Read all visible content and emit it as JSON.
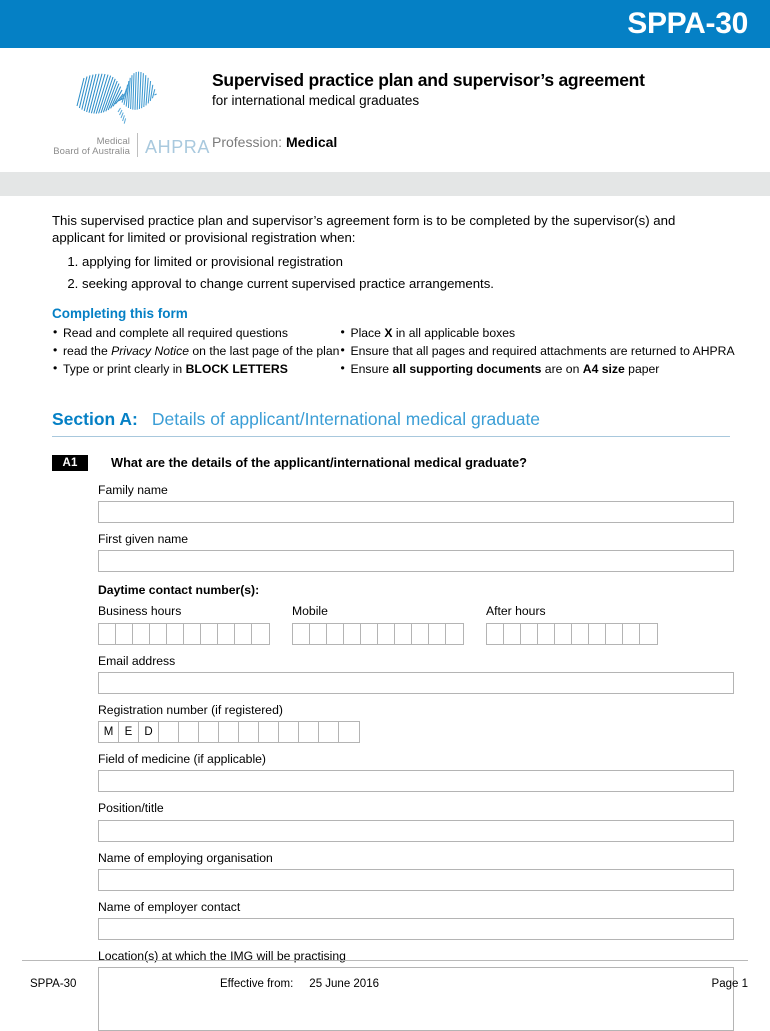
{
  "header": {
    "form_code": "SPPA-30"
  },
  "masthead": {
    "logo": {
      "board_line1": "Medical",
      "board_line2": "Board of Australia",
      "agency": "AHPRA",
      "mark_name": "australia-map-logo"
    },
    "title": "Supervised practice plan and supervisor’s agreement",
    "subtitle": "for international medical graduates",
    "profession_label": "Profession:",
    "profession_value": "Medical"
  },
  "intro": {
    "paragraph": "This supervised practice plan and supervisor’s agreement form is to be completed by the supervisor(s) and applicant for limited or provisional registration when:",
    "items": [
      "applying for limited or provisional registration",
      "seeking approval to change current supervised practice arrangements."
    ]
  },
  "completing": {
    "heading": "Completing this form",
    "left": [
      {
        "plain": "Read and complete all required questions"
      },
      {
        "pre": "read the ",
        "em": "Privacy Notice",
        "post": " on the last page of the plan"
      },
      {
        "pre": "Type or print clearly in ",
        "strong": "BLOCK LETTERS",
        "post": ""
      }
    ],
    "right": [
      {
        "pre": "Place ",
        "strong": "X",
        "post": " in all applicable boxes"
      },
      {
        "plain": "Ensure that all pages and required attachments are returned to AHPRA"
      },
      {
        "pre": "Ensure ",
        "strong": "all supporting documents",
        "post": " are on ",
        "strong2": "A4 size",
        "post2": " paper"
      }
    ]
  },
  "section": {
    "label": "Section A:",
    "title": "Details of applicant/International medical graduate"
  },
  "question": {
    "badge": "A1",
    "text": "What are the details of the applicant/international medical graduate?"
  },
  "fields": {
    "family_name": {
      "label": "Family name",
      "value": ""
    },
    "first_given_name": {
      "label": "First given name",
      "value": ""
    },
    "daytime_heading": "Daytime contact number(s):",
    "business_hours": {
      "label": "Business hours",
      "boxes": 10,
      "value": ""
    },
    "mobile": {
      "label": "Mobile",
      "boxes": 10,
      "value": ""
    },
    "after_hours": {
      "label": "After hours",
      "boxes": 10,
      "value": ""
    },
    "email": {
      "label": "Email address",
      "value": ""
    },
    "registration_number": {
      "label": "Registration number  (if registered)",
      "prefix": [
        "M",
        "E",
        "D"
      ],
      "boxes": 10,
      "value": ""
    },
    "field_of_medicine": {
      "label": "Field of medicine (if applicable)",
      "value": ""
    },
    "position_title": {
      "label": "Position/title",
      "value": ""
    },
    "employing_organisation": {
      "label": "Name of employing organisation",
      "value": ""
    },
    "employer_contact": {
      "label": "Name of employer contact",
      "value": ""
    },
    "locations": {
      "label": "Location(s) at which the IMG will be practising",
      "value": ""
    }
  },
  "footer": {
    "form_code": "SPPA-30",
    "effective_label": "Effective from:",
    "effective_date": "25 June 2016",
    "page": "Page 1"
  },
  "colors": {
    "brand_blue": "#0580c5",
    "section_title_blue": "#3b9ed6",
    "grey_band": "#e4e6e6",
    "field_border": "#b4b4b4"
  }
}
